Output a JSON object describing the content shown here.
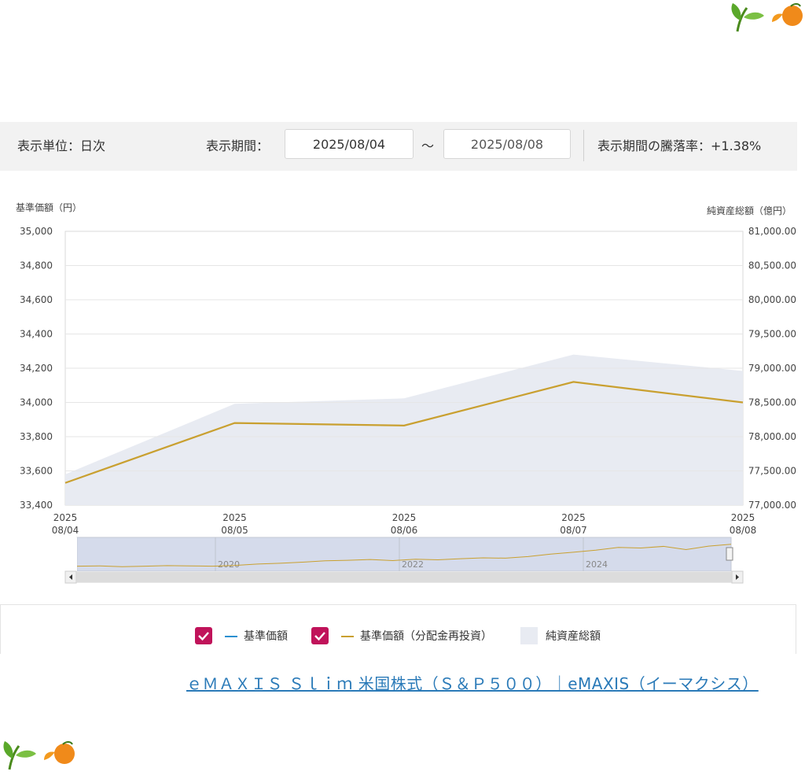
{
  "controls": {
    "unit_label": "表示単位：日次",
    "period_label": "表示期間：",
    "start_date": "2025/08/04",
    "tilde": "～",
    "end_date": "2025/08/08",
    "change_label": "表示期間の騰落率：+1.38%"
  },
  "chart_data": {
    "type": "line",
    "left_axis_title": "基準価額（円）",
    "right_axis_title": "純資産総額（億円）",
    "y_left": {
      "range": [
        33400,
        35000
      ],
      "ticks": [
        "35,000",
        "34,800",
        "34,600",
        "34,400",
        "34,200",
        "34,000",
        "33,800",
        "33,600",
        "33,400"
      ]
    },
    "y_right": {
      "range": [
        77000,
        81000
      ],
      "ticks": [
        "81,000.00",
        "80,500.00",
        "80,000.00",
        "79,500.00",
        "79,000.00",
        "78,500.00",
        "78,000.00",
        "77,500.00",
        "77,000.00"
      ]
    },
    "x": [
      {
        "year": "2025",
        "date": "08/04"
      },
      {
        "year": "2025",
        "date": "08/05"
      },
      {
        "year": "2025",
        "date": "08/06"
      },
      {
        "year": "2025",
        "date": "08/07"
      },
      {
        "year": "2025",
        "date": "08/08"
      }
    ],
    "series": [
      {
        "name": "基準価額（分配金再投資）",
        "axis": "left",
        "color": "#c9a030",
        "values": [
          33530,
          33880,
          33865,
          34120,
          34000
        ]
      },
      {
        "name": "純資産総額",
        "axis": "right",
        "color": "#e8ebf2",
        "type": "area",
        "values": [
          77450,
          78480,
          78560,
          79200,
          78960
        ]
      }
    ],
    "navigator": {
      "years": [
        "2020",
        "2022",
        "2024"
      ]
    },
    "grid": true
  },
  "legend": {
    "items": [
      {
        "label": "基準価額",
        "color": "#2a8fd0"
      },
      {
        "label": "基準価額（分配金再投資）",
        "color": "#c9a030"
      },
      {
        "label": "純資産総額",
        "color": "#e8ebf2"
      }
    ],
    "check_color": "#c0135a"
  },
  "link": {
    "text": "ｅＭＡＸＩＳ Ｓｌｉｍ 米国株式（Ｓ＆Ｐ５００）｜eMAXIS（イーマクシス）"
  }
}
